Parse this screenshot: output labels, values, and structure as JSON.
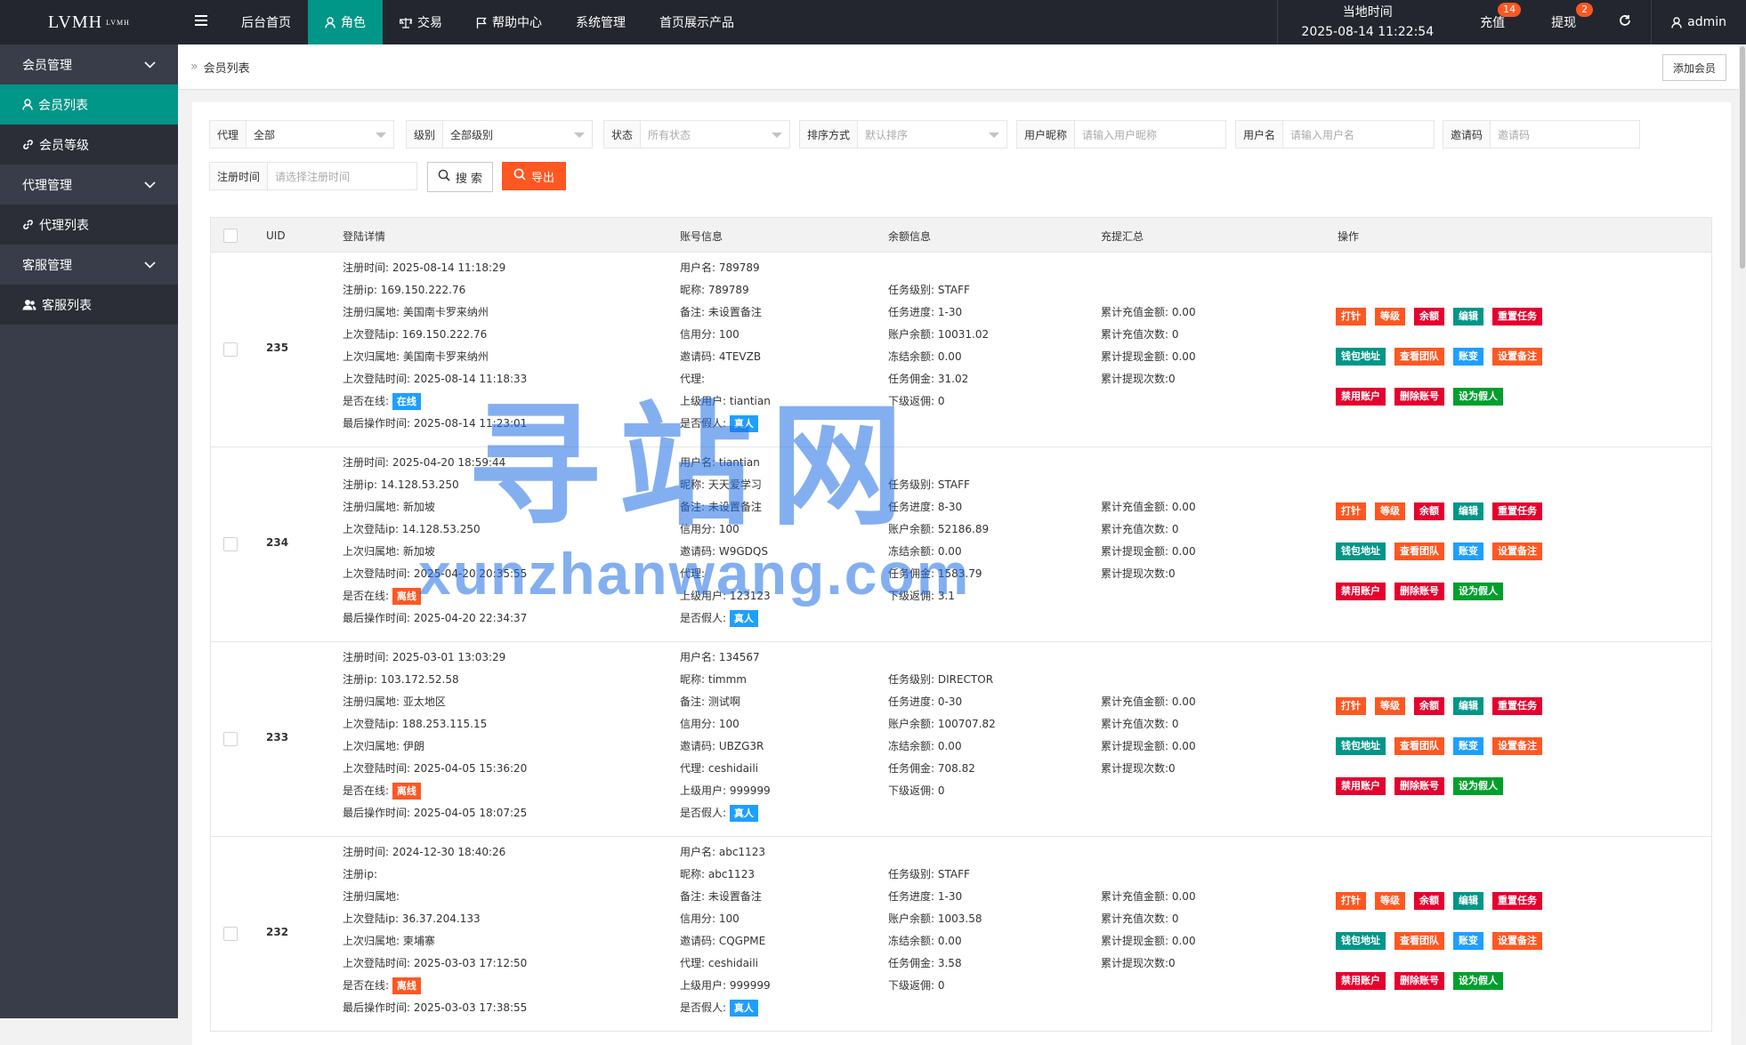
{
  "app": {
    "logo": "LVMH",
    "logo_sup": "LVMH"
  },
  "nav": [
    {
      "label": "后台首页",
      "icon": ""
    },
    {
      "label": "角色",
      "icon": "user-icon",
      "active": true
    },
    {
      "label": "交易",
      "icon": "scale-icon"
    },
    {
      "label": "帮助中心",
      "icon": "flag-icon"
    },
    {
      "label": "系统管理",
      "icon": ""
    },
    {
      "label": "首页展示产品",
      "icon": ""
    }
  ],
  "header": {
    "time_label": "当地时间",
    "time_value": "2025-08-14 11:22:54",
    "recharge_label": "充值",
    "recharge_badge": "14",
    "withdraw_label": "提现",
    "withdraw_badge": "2",
    "user": "admin"
  },
  "sidebar": {
    "groups": [
      {
        "label": "会员管理",
        "items": [
          {
            "label": "会员列表",
            "icon": "user-icon",
            "active": true
          },
          {
            "label": "会员等级",
            "icon": "link-icon"
          }
        ]
      },
      {
        "label": "代理管理",
        "items": [
          {
            "label": "代理列表",
            "icon": "link-icon"
          }
        ]
      },
      {
        "label": "客服管理",
        "items": [
          {
            "label": "客服列表",
            "icon": "users-icon"
          }
        ]
      }
    ]
  },
  "breadcrumb": {
    "current": "会员列表",
    "add_button": "添加会员"
  },
  "filters": {
    "agent": {
      "label": "代理",
      "value": "全部"
    },
    "level": {
      "label": "级别",
      "value": "全部级别"
    },
    "status": {
      "label": "状态",
      "placeholder": "所有状态"
    },
    "sort": {
      "label": "排序方式",
      "placeholder": "默认排序"
    },
    "nickname": {
      "label": "用户昵称",
      "placeholder": "请输入用户昵称"
    },
    "username": {
      "label": "用户名",
      "placeholder": "请输入用户名"
    },
    "invite": {
      "label": "邀请码",
      "placeholder": "邀请码"
    },
    "regtime": {
      "label": "注册时间",
      "placeholder": "请选择注册时间"
    },
    "search_button": "搜 索",
    "export_button": "导出"
  },
  "table": {
    "headers": {
      "uid": "UID",
      "login": "登陆详情",
      "account": "账号信息",
      "balance": "余额信息",
      "recharge": "充提汇总",
      "ops": "操作"
    },
    "op_labels": {
      "row1": [
        "打针",
        "等级",
        "余额",
        "编辑",
        "重置任务"
      ],
      "row2": [
        "钱包地址",
        "查看团队",
        "账变",
        "设置备注"
      ],
      "row3": [
        "禁用账户",
        "删除账号",
        "设为假人"
      ]
    },
    "rows": [
      {
        "uid": "235",
        "login": [
          "注册时间:  2025-08-14 11:18:29",
          "注册ip: 169.150.222.76",
          "注册归属地: 美国南卡罗来纳州",
          "上次登陆ip: 169.150.222.76",
          "上次归属地: 美国南卡罗来纳州",
          "上次登陆时间: 2025-08-14 11:18:33"
        ],
        "online_label": "是否在线:",
        "online_tag": "在线",
        "online_color": "blue",
        "last_op": "最后操作时间: 2025-08-14 11:23:01",
        "account": [
          "用户名: 789789",
          "昵称: 789789",
          "备注: 未设置备注",
          "信用分: 100",
          "邀请码: 4TEVZB",
          "代理:",
          "上级用户: tiantian"
        ],
        "fake_label": "是否假人:",
        "fake_tag": "真人",
        "balance": [
          "任务级别: STAFF",
          "任务进度: 1-30",
          "账户余额: 10031.02",
          "冻结余额: 0.00",
          "任务佣金: 31.02",
          "下级返佣: 0"
        ],
        "recharge": [
          "累计充值金额: 0.00",
          "累计充值次数: 0",
          "累计提现金额: 0.00",
          "累计提现次数:0"
        ]
      },
      {
        "uid": "234",
        "login": [
          "注册时间:  2025-04-20 18:59:44",
          "注册ip: 14.128.53.250",
          "注册归属地: 新加坡",
          "上次登陆ip: 14.128.53.250",
          "上次归属地: 新加坡",
          "上次登陆时间: 2025-04-20 20:35:55"
        ],
        "online_label": "是否在线:",
        "online_tag": "离线",
        "online_color": "orange",
        "last_op": "最后操作时间: 2025-04-20 22:34:37",
        "account": [
          "用户名: tiantian",
          "昵称: 天天爱学习",
          "备注: 未设置备注",
          "信用分: 100",
          "邀请码: W9GDQS",
          "代理:",
          "上级用户: 123123"
        ],
        "fake_label": "是否假人:",
        "fake_tag": "真人",
        "balance": [
          "任务级别: STAFF",
          "任务进度: 8-30",
          "账户余额: 52186.89",
          "冻结余额: 0.00",
          "任务佣金: 1583.79",
          "下级返佣: 3.1"
        ],
        "recharge": [
          "累计充值金额: 0.00",
          "累计充值次数: 0",
          "累计提现金额: 0.00",
          "累计提现次数:0"
        ]
      },
      {
        "uid": "233",
        "login": [
          "注册时间:  2025-03-01 13:03:29",
          "注册ip: 103.172.52.58",
          "注册归属地: 亚太地区",
          "上次登陆ip: 188.253.115.15",
          "上次归属地: 伊朗",
          "上次登陆时间: 2025-04-05 15:36:20"
        ],
        "online_label": "是否在线:",
        "online_tag": "离线",
        "online_color": "orange",
        "last_op": "最后操作时间: 2025-04-05 18:07:25",
        "account": [
          "用户名: 134567",
          "昵称: timmm",
          "备注: 测试啊",
          "信用分: 100",
          "邀请码: UBZG3R",
          "代理: ceshidaili",
          "上级用户: 999999"
        ],
        "fake_label": "是否假人:",
        "fake_tag": "真人",
        "balance": [
          "任务级别: DIRECTOR",
          "任务进度: 0-30",
          "账户余额: 100707.82",
          "冻结余额: 0.00",
          "任务佣金: 708.82",
          "下级返佣: 0"
        ],
        "recharge": [
          "累计充值金额: 0.00",
          "累计充值次数: 0",
          "累计提现金额: 0.00",
          "累计提现次数:0"
        ]
      },
      {
        "uid": "232",
        "login": [
          "注册时间:  2024-12-30 18:40:26",
          "注册ip:",
          "注册归属地:",
          "上次登陆ip: 36.37.204.133",
          "上次归属地: 柬埔寨",
          "上次登陆时间: 2025-03-03 17:12:50"
        ],
        "online_label": "是否在线:",
        "online_tag": "离线",
        "online_color": "orange",
        "last_op": "最后操作时间: 2025-03-03 17:38:55",
        "account": [
          "用户名: abc1123",
          "昵称: abc1123",
          "备注: 未设置备注",
          "信用分: 100",
          "邀请码: CQGPME",
          "代理: ceshidaili",
          "上级用户: 999999"
        ],
        "fake_label": "是否假人:",
        "fake_tag": "真人",
        "balance": [
          "任务级别: STAFF",
          "任务进度: 1-30",
          "账户余额: 1003.58",
          "冻结余额: 0.00",
          "任务佣金: 3.58",
          "下级返佣: 0"
        ],
        "recharge": [
          "累计充值金额: 0.00",
          "累计充值次数: 0",
          "累计提现金额: 0.00",
          "累计提现次数:0"
        ]
      }
    ]
  },
  "watermark": {
    "line1": "寻站网",
    "line2": "xunzhanwang.com"
  },
  "colors": {
    "topbar": "#23262e",
    "sidebar": "#393d49",
    "accent": "#009688",
    "orange": "#ff5722",
    "blue": "#1e9fff",
    "red": "#e5002e",
    "green": "#009f2c"
  }
}
